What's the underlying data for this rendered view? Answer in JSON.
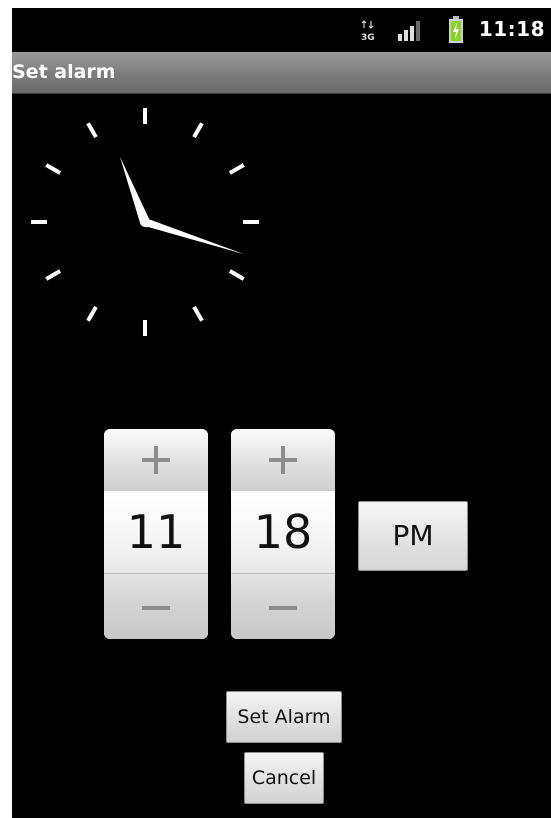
{
  "status_bar": {
    "network_type": "3G",
    "time": "11:18",
    "icons": [
      "network-3g-icon",
      "signal-strength-icon",
      "battery-charging-icon"
    ],
    "battery_color": "#8ad12a"
  },
  "title_bar": {
    "title": "Set alarm"
  },
  "analog_clock": {
    "hour": 11,
    "minute": 18,
    "hand_color": "#ffffff"
  },
  "time_picker": {
    "hour": {
      "value": "11",
      "increment_icon": "plus-icon",
      "decrement_icon": "minus-icon"
    },
    "minute": {
      "value": "18",
      "increment_icon": "plus-icon",
      "decrement_icon": "minus-icon"
    },
    "am_pm": "PM"
  },
  "actions": {
    "set_alarm_label": "Set Alarm",
    "cancel_label": "Cancel"
  }
}
